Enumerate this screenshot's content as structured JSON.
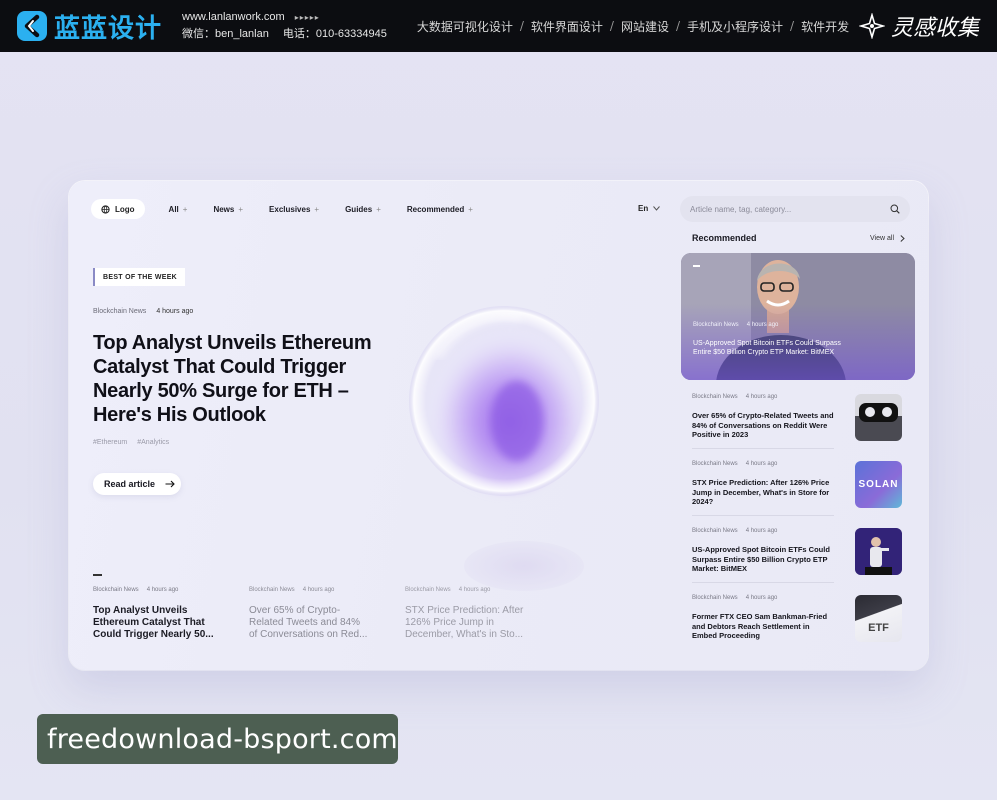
{
  "banner": {
    "brand_name": "蓝蓝设计",
    "website": "www.lanlanwork.com",
    "arrows": "▸▸▸▸▸",
    "wechat": "微信：ben_lanlan",
    "phone": "电话：010-63334945",
    "services": [
      "大数据可视化设计",
      "软件界面设计",
      "网站建设",
      "手机及小程序设计",
      "软件开发"
    ],
    "separator": "/",
    "inspiration": "灵感收集"
  },
  "nav": {
    "logo": "Logo",
    "items": [
      "All",
      "News",
      "Exclusives",
      "Guides",
      "Recommended"
    ],
    "plus": "+",
    "language": "En",
    "search_placeholder": "Article name, tag, category..."
  },
  "hero": {
    "badge": "BEST OF THE WEEK",
    "category": "Blockchain News",
    "time": "4 hours ago",
    "title": "Top Analyst Unveils Ethereum Catalyst That Could Trigger Nearly 50% Surge for ETH – Here's His Outlook",
    "tags": [
      "#Ethereum",
      "#Analytics"
    ],
    "cta": "Read article"
  },
  "bottom_news": [
    {
      "category": "Blockchain News",
      "time": "4 hours ago",
      "title": "Top Analyst Unveils Ethereum Catalyst That Could Trigger Nearly 50..."
    },
    {
      "category": "Blockchain News",
      "time": "4 hours ago",
      "title": "Over 65% of Crypto-Related Tweets and 84% of Conversations on Red..."
    },
    {
      "category": "Blockchain News",
      "time": "4 hours ago",
      "title": "STX Price Prediction: After 126% Price Jump in December, What's in Sto..."
    }
  ],
  "recommended": {
    "heading": "Recommended",
    "view_all": "View all",
    "feature": {
      "category": "Blockchain News",
      "time": "4 hours ago",
      "title": "US-Approved Spot Bitcoin ETFs Could Surpass Entire $50 Billion Crypto ETP Market: BitMEX"
    },
    "items": [
      {
        "category": "Blockchain News",
        "time": "4 hours ago",
        "title": "Over 65% of Crypto-Related Tweets and 84% of Conversations on Reddit Were Positive in 2023"
      },
      {
        "category": "Blockchain News",
        "time": "4 hours ago",
        "title": "STX Price Prediction: After 126% Price Jump in December, What's in Store for 2024?",
        "thumb_text": "SOLAN"
      },
      {
        "category": "Blockchain News",
        "time": "4 hours ago",
        "title": "US-Approved Spot Bitcoin ETFs Could Surpass Entire $50 Billion Crypto ETP Market: BitMEX"
      },
      {
        "category": "Blockchain News",
        "time": "4 hours ago",
        "title": "Former FTX CEO Sam Bankman-Fried and Debtors Reach Settlement in Embed Proceeding",
        "thumb_text": "ETF"
      }
    ]
  },
  "watermark": "freedownload-bsport.com",
  "colors": {
    "background": "#e2e2f2",
    "banner": "#0c0d11",
    "brand": "#2bb0f0",
    "accent_purple": "#7b5cd6",
    "watermark_bg": "#4d5f52"
  }
}
